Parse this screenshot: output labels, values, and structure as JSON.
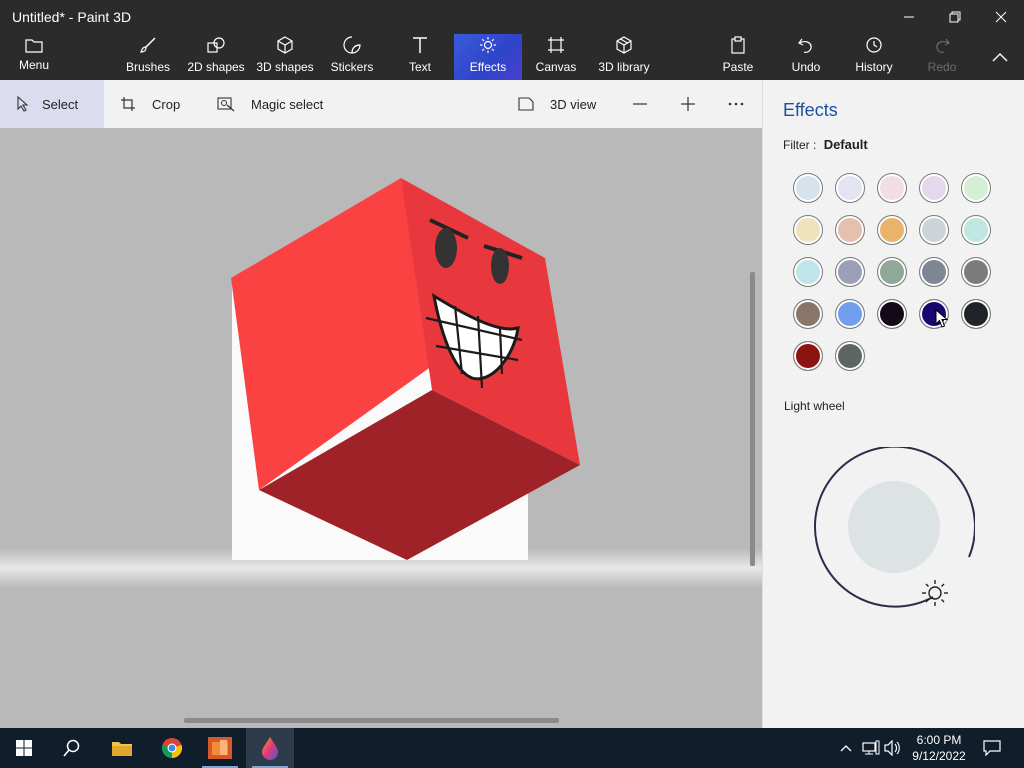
{
  "window": {
    "title": "Untitled* - Paint 3D"
  },
  "ribbon": {
    "menu": "Menu",
    "brushes": "Brushes",
    "shapes2d": "2D shapes",
    "shapes3d": "3D shapes",
    "stickers": "Stickers",
    "text": "Text",
    "effects": "Effects",
    "canvas": "Canvas",
    "library3d": "3D library",
    "paste": "Paste",
    "undo": "Undo",
    "history": "History",
    "redo": "Redo"
  },
  "toolbar": {
    "select": "Select",
    "crop": "Crop",
    "magic_select": "Magic select",
    "view3d": "3D view"
  },
  "panel": {
    "title": "Effects",
    "filter_label": "Filter :",
    "filter_value": "Default",
    "light_wheel_label": "Light wheel",
    "swatches": [
      "#d6e2ec",
      "#e2e4f2",
      "#f0dde6",
      "#e6d8ec",
      "#d4efd6",
      "#eee3bb",
      "#e6bfae",
      "#e8b36a",
      "#ccd4d8",
      "#bfe6e0",
      "#bfe5ea",
      "#9c9fb8",
      "#8fa898",
      "#7d8894",
      "#7b7b7d",
      "#8a7668",
      "#6f9fee",
      "#150818",
      "#16086e",
      "#202428",
      "#8b1410",
      "#5d6662"
    ]
  },
  "taskbar": {
    "time": "6:00 PM",
    "date": "9/12/2022"
  }
}
